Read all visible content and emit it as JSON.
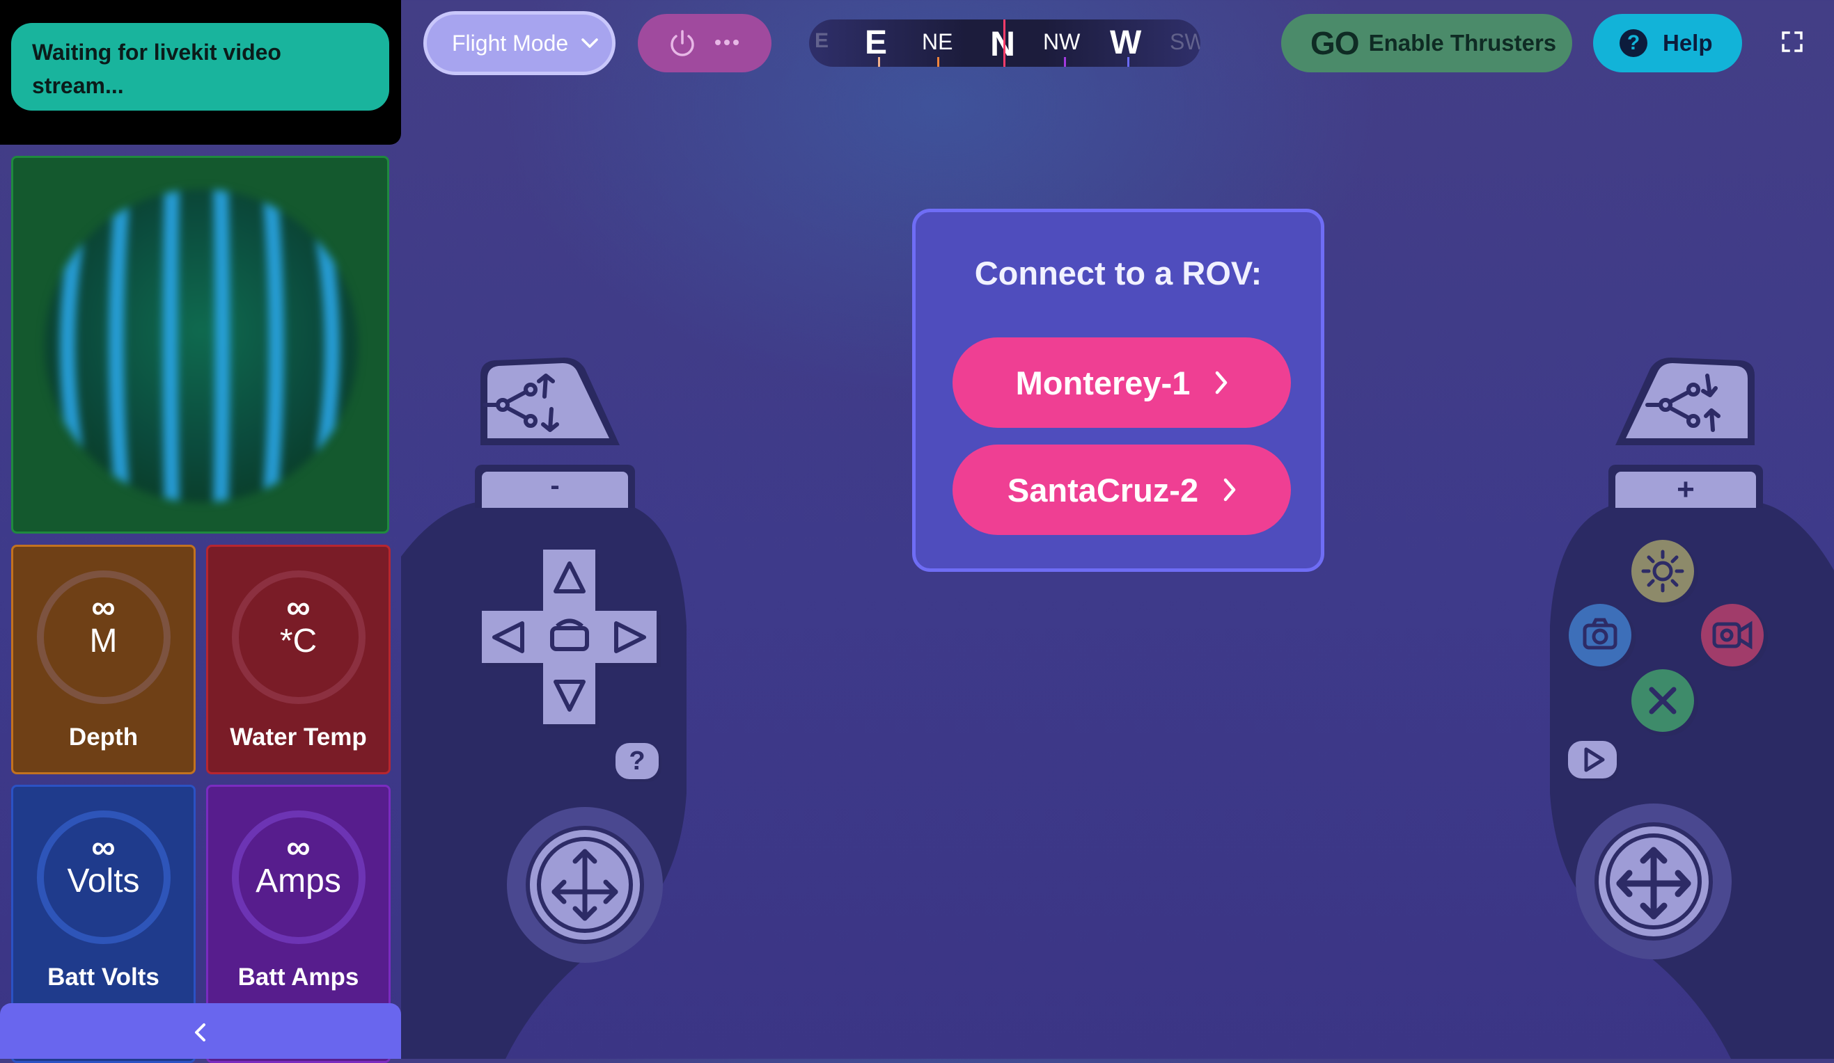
{
  "video": {
    "status": "Waiting for livekit video stream..."
  },
  "telemetry": [
    {
      "id": "depth",
      "value": "∞",
      "unit": "M",
      "label": "Depth"
    },
    {
      "id": "temp",
      "value": "∞",
      "unit": "*C",
      "label": "Water Temp"
    },
    {
      "id": "volts",
      "value": "∞",
      "unit": "Volts",
      "label": "Batt Volts"
    },
    {
      "id": "amps",
      "value": "∞",
      "unit": "Amps",
      "label": "Batt Amps"
    }
  ],
  "header": {
    "flight_mode": "Flight Mode",
    "compass": [
      "E",
      "NE",
      "N",
      "NW",
      "W",
      "SW"
    ],
    "thrusters_icon_text": "GO",
    "thrusters_label": "Enable Thrusters",
    "help_icon_text": "?",
    "help_label": "Help"
  },
  "connect": {
    "title": "Connect to a ROV:",
    "rovs": [
      "Monterey-1",
      "SantaCruz-2"
    ]
  },
  "gamepad": {
    "left_bumper_label": "-",
    "right_bumper_label": "+",
    "help_key": "?"
  },
  "colors": {
    "accent": "#6966ee",
    "rov_button": "#ef3f93",
    "thrusters": "#4b8b6a",
    "help": "#12b3d8"
  }
}
